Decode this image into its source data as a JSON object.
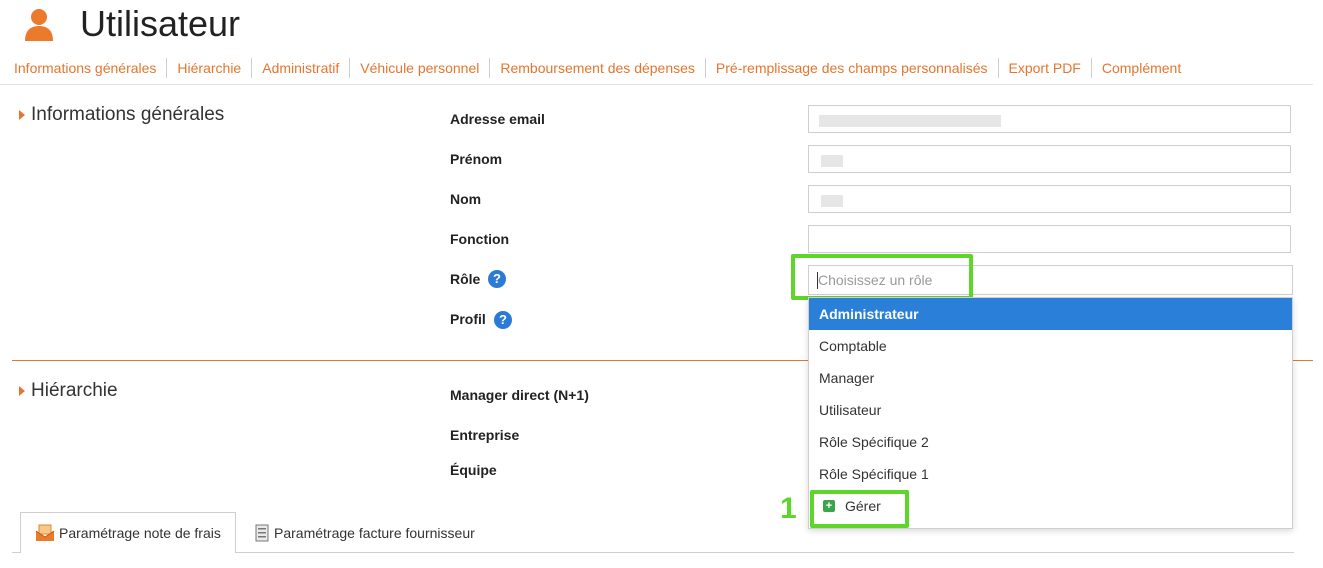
{
  "header": {
    "title": "Utilisateur",
    "icon": "user-icon"
  },
  "nav": {
    "items": [
      "Informations générales",
      "Hiérarchie",
      "Administratif",
      "Véhicule personnel",
      "Remboursement des dépenses",
      "Pré-remplissage des champs personnalisés",
      "Export PDF",
      "Complément"
    ]
  },
  "general_section": {
    "title": "Informations générales",
    "labels": {
      "email": "Adresse email",
      "firstname": "Prénom",
      "lastname": "Nom",
      "function": "Fonction",
      "role": "Rôle",
      "profile": "Profil"
    },
    "role_placeholder": "Choisissez un rôle"
  },
  "hierarchy_section": {
    "title": "Hiérarchie",
    "labels": {
      "manager": "Manager direct (N+1)",
      "company": "Entreprise",
      "team": "Équipe"
    }
  },
  "role_dropdown": {
    "options": [
      "Administrateur",
      "Comptable",
      "Manager",
      "Utilisateur",
      "Rôle Spécifique 2",
      "Rôle Spécifique 1"
    ],
    "selected": "Administrateur",
    "manage_label": "Gérer"
  },
  "annotation": {
    "step": "1",
    "highlight_color": "#5ed629"
  },
  "tabs": {
    "expense": "Paramétrage note de frais",
    "invoice": "Paramétrage facture fournisseur"
  },
  "colors": {
    "accent": "#e4762f",
    "selected": "#2a7fd8",
    "help": "#2b7bd6"
  }
}
